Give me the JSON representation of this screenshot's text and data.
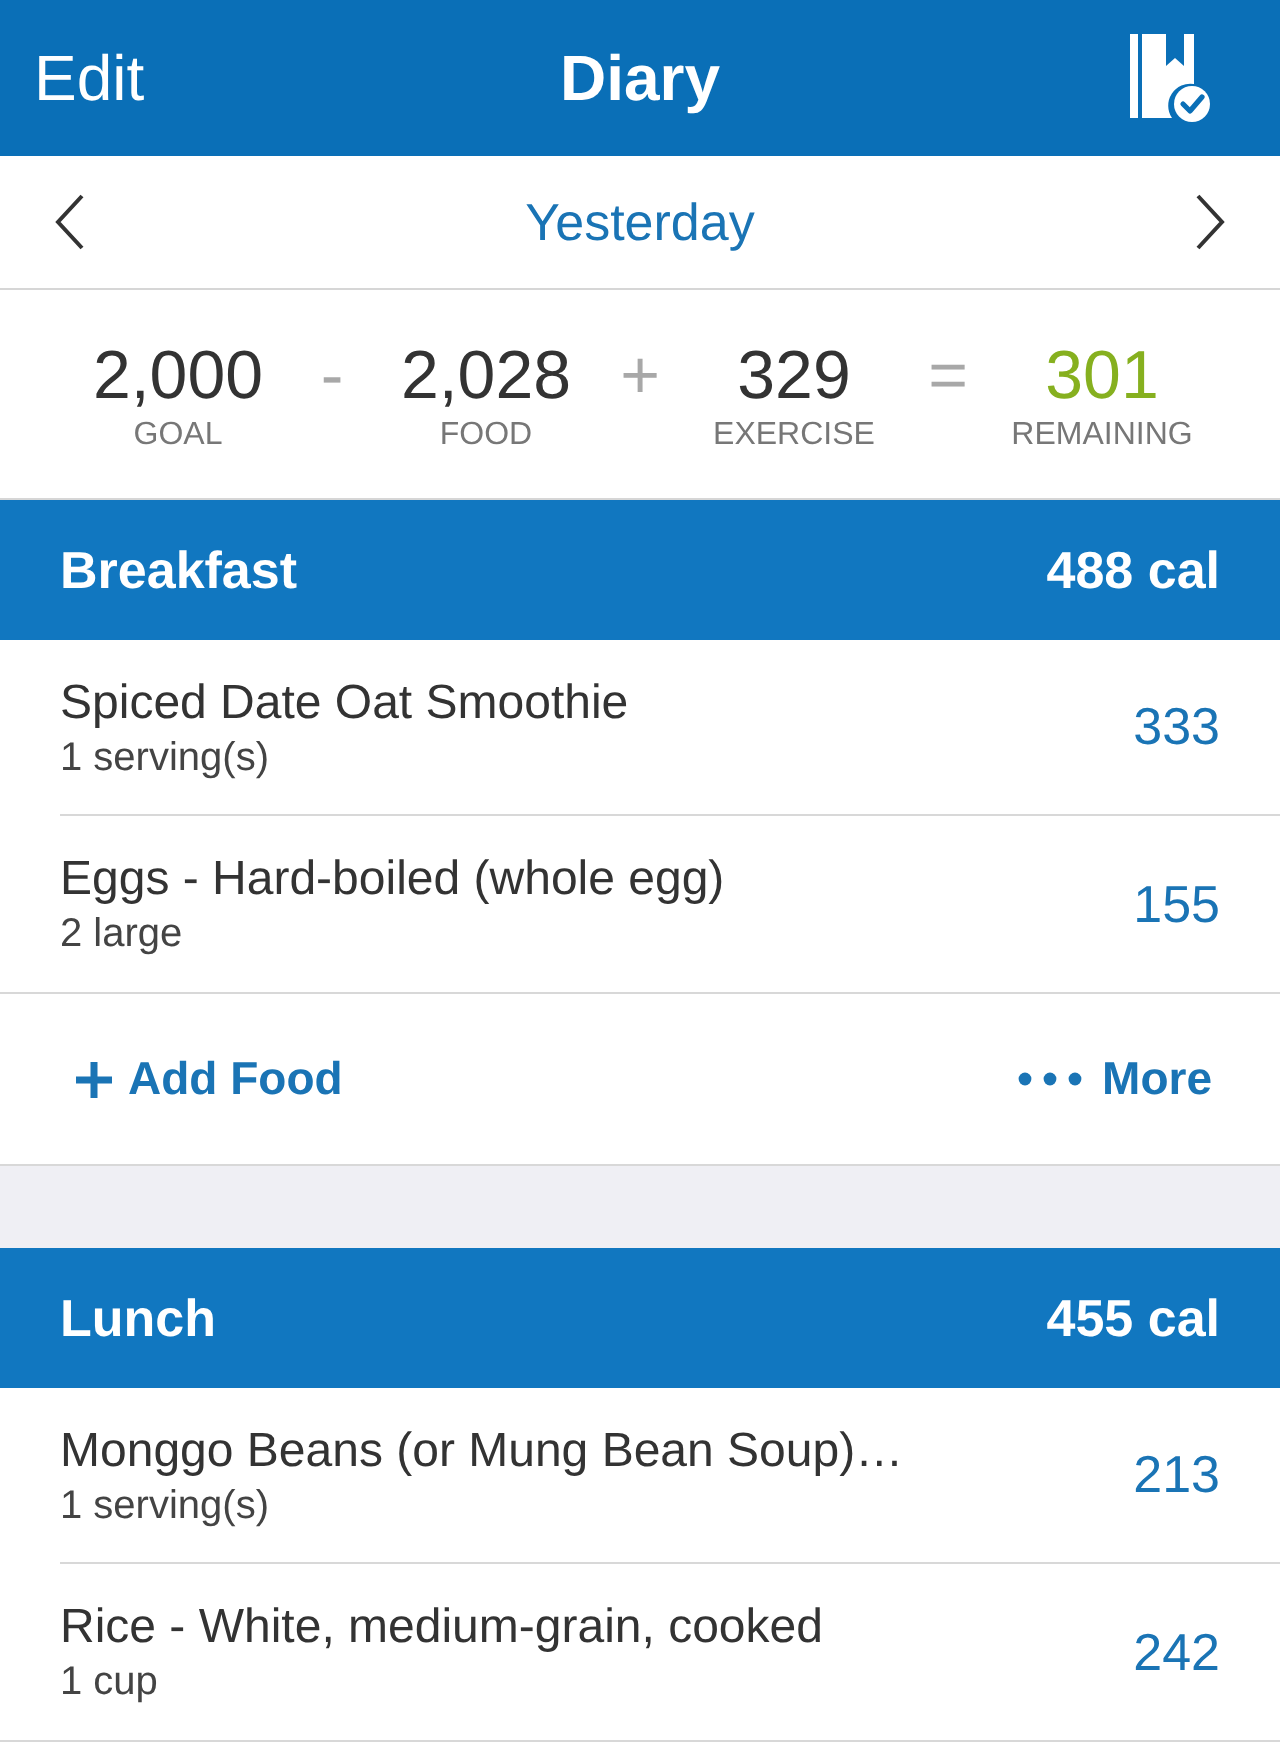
{
  "header": {
    "left_action": "Edit",
    "title": "Diary"
  },
  "date_nav": {
    "label": "Yesterday"
  },
  "summary": [
    {
      "kind": "term",
      "value": "2,000",
      "label": "GOAL"
    },
    {
      "kind": "operator",
      "symbol": "-"
    },
    {
      "kind": "term",
      "value": "2,028",
      "label": "FOOD"
    },
    {
      "kind": "operator",
      "symbol": "+"
    },
    {
      "kind": "term",
      "value": "329",
      "label": "EXERCISE"
    },
    {
      "kind": "operator",
      "symbol": "="
    },
    {
      "kind": "result",
      "value": "301",
      "label": "REMAINING"
    }
  ],
  "meals": [
    {
      "name": "Breakfast",
      "calories": "488 cal",
      "entries": [
        {
          "name": "Spiced Date Oat Smoothie",
          "serving": "1 serving(s)",
          "calories": "333"
        },
        {
          "name": "Eggs - Hard-boiled (whole egg)",
          "serving": "2 large",
          "calories": "155"
        }
      ],
      "actions": {
        "add": "Add Food",
        "more": "More"
      }
    },
    {
      "name": "Lunch",
      "calories": "455 cal",
      "entries": [
        {
          "name": "Monggo Beans (or Mung Bean Soup)…",
          "serving": "1 serving(s)",
          "calories": "213"
        },
        {
          "name": "Rice - White, medium-grain, cooked",
          "serving": "1 cup",
          "calories": "242"
        }
      ]
    }
  ]
}
